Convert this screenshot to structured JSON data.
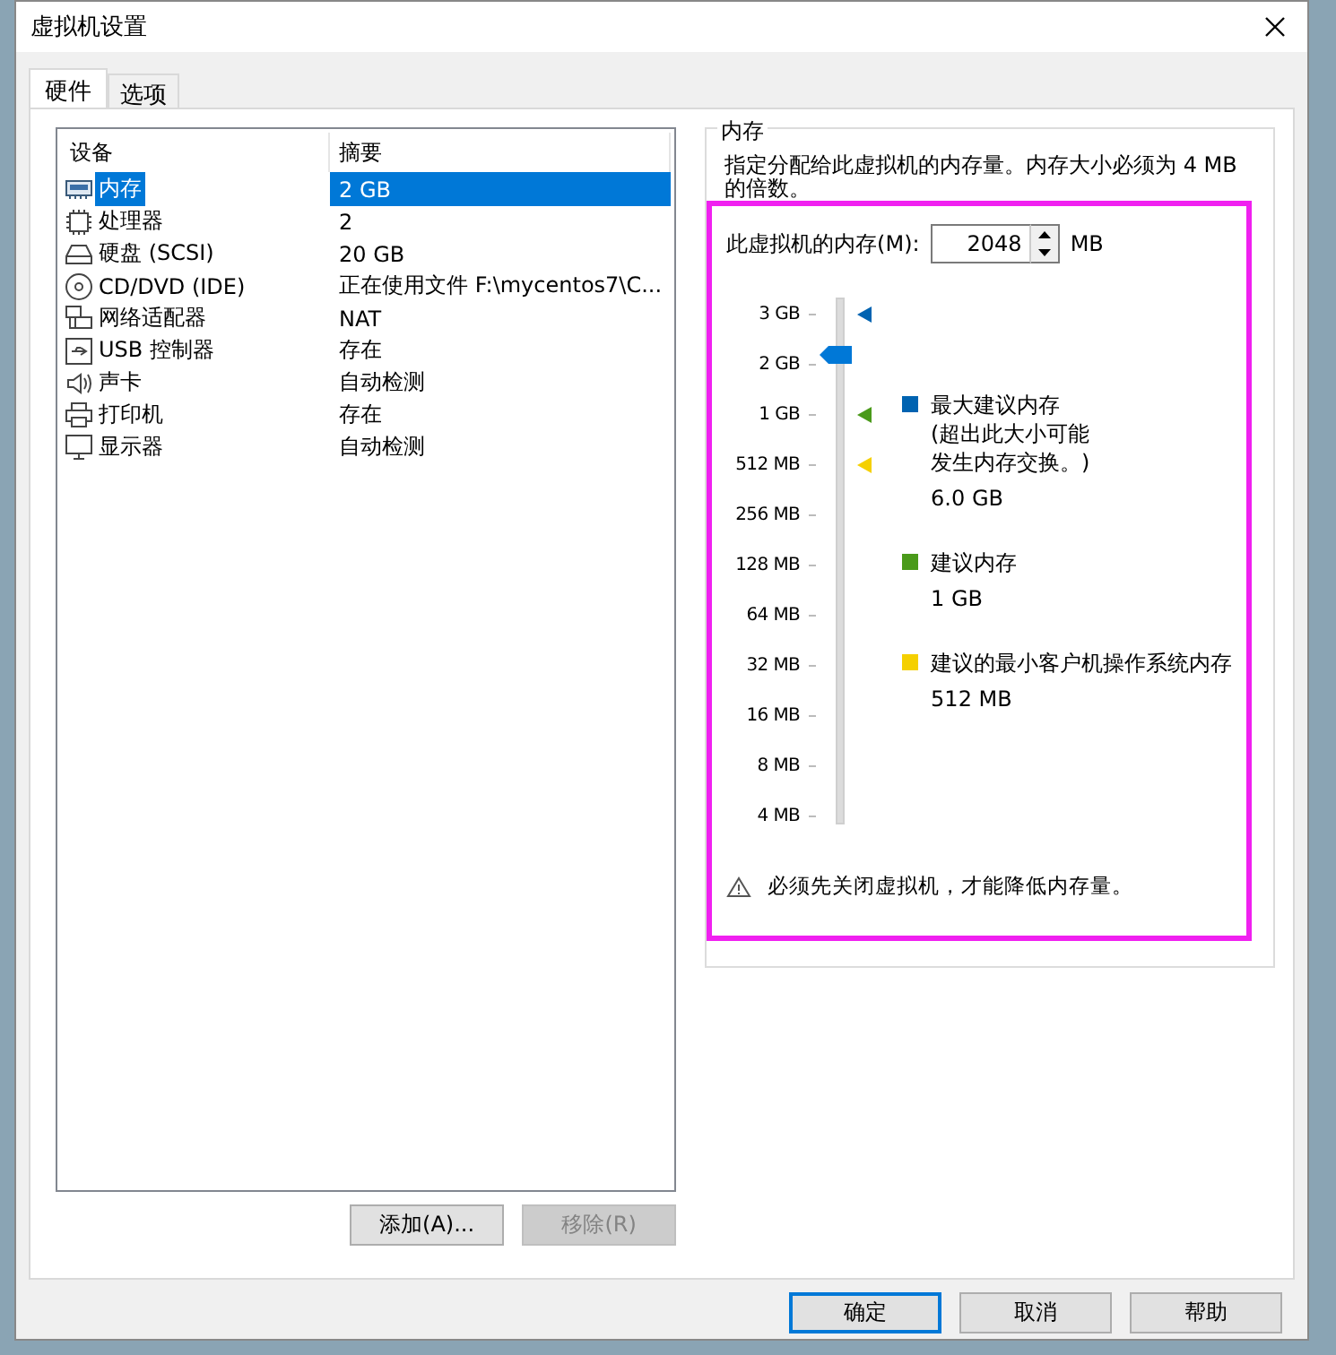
{
  "window": {
    "title": "虚拟机设置"
  },
  "tabs": [
    {
      "label": "硬件",
      "selected": true
    },
    {
      "label": "选项",
      "selected": false
    }
  ],
  "device_list": {
    "columns": [
      "设备",
      "摘要"
    ],
    "rows": [
      {
        "kind": "memory",
        "device": "内存",
        "summary": "2 GB",
        "selected": true
      },
      {
        "kind": "cpu",
        "device": "处理器",
        "summary": "2",
        "selected": false
      },
      {
        "kind": "disk",
        "device": "硬盘 (SCSI)",
        "summary": "20 GB",
        "selected": false
      },
      {
        "kind": "cd",
        "device": "CD/DVD (IDE)",
        "summary": "正在使用文件 F:\\mycentos7\\C...",
        "selected": false
      },
      {
        "kind": "network",
        "device": "网络适配器",
        "summary": "NAT",
        "selected": false
      },
      {
        "kind": "usb",
        "device": "USB 控制器",
        "summary": "存在",
        "selected": false
      },
      {
        "kind": "sound",
        "device": "声卡",
        "summary": "自动检测",
        "selected": false
      },
      {
        "kind": "printer",
        "device": "打印机",
        "summary": "存在",
        "selected": false
      },
      {
        "kind": "display",
        "device": "显示器",
        "summary": "自动检测",
        "selected": false
      }
    ]
  },
  "list_buttons": [
    {
      "label": "添加(A)...",
      "disabled": false
    },
    {
      "label": "移除(R)",
      "disabled": true
    }
  ],
  "memory": {
    "title": "内存",
    "description": "指定分配给此虚拟机的内存量。内存大小必须为 4 MB 的倍数。",
    "highlight": true,
    "field_label": "此虚拟机的内存(M):",
    "value": "2048",
    "unit": "MB",
    "slider": {
      "level": 0.9,
      "ticks": [
        {
          "label": "3 GB",
          "color": "#0063b1"
        },
        {
          "label": "2 GB"
        },
        {
          "label": "1 GB",
          "color": "#4a9a1a"
        },
        {
          "label": "512 MB",
          "color": "#f5d000"
        },
        {
          "label": "256 MB"
        },
        {
          "label": "128 MB"
        },
        {
          "label": "64 MB"
        },
        {
          "label": "32 MB"
        },
        {
          "label": "16 MB"
        },
        {
          "label": "8 MB"
        },
        {
          "label": "4 MB"
        }
      ]
    },
    "legend": [
      {
        "color": "#0063b1",
        "title": "最大建议内存",
        "note": [
          "(超出此大小可能",
          "发生内存交换。)"
        ],
        "value": "6.0 GB"
      },
      {
        "color": "#4a9a1a",
        "title": "建议内存",
        "value": "1 GB"
      },
      {
        "color": "#f5d000",
        "title": "建议的最小客户机操作系统内存",
        "value": "512 MB"
      }
    ],
    "warning": "必须先关闭虚拟机，才能降低内存量。"
  },
  "buttons": [
    {
      "label": "确定",
      "default": true
    },
    {
      "label": "取消",
      "default": false
    },
    {
      "label": "帮助",
      "default": false
    }
  ]
}
